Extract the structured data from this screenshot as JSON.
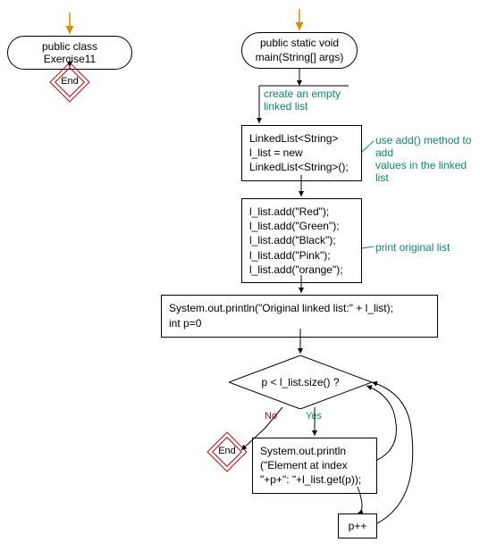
{
  "left": {
    "terminal": "public class Exercise11",
    "end": "End"
  },
  "right": {
    "terminal": "public static void\nmain(String[] args)",
    "annot_create": "create an empty\nlinked list",
    "proc_decl": "LinkedList<String>\nl_list = new\nLinkedList<String>();",
    "annot_add": "use add() method to add\nvalues in the linked list",
    "proc_adds": "l_list.add(\"Red\");\nl_list.add(\"Green\");\nl_list.add(\"Black\");\nl_list.add(\"Pink\");\nl_list.add(\"orange\");",
    "annot_print": "print original list",
    "proc_print": "System.out.println(\"Original linked list:\" + l_list);\nint p=0",
    "decision": "p < l_list.size() ?",
    "edge_no": "No",
    "edge_yes": "Yes",
    "end": "End",
    "proc_loop": "System.out.println\n(\"Element at index\n\"+p+\": \"+l_list.get(p));",
    "proc_inc": "p++"
  }
}
